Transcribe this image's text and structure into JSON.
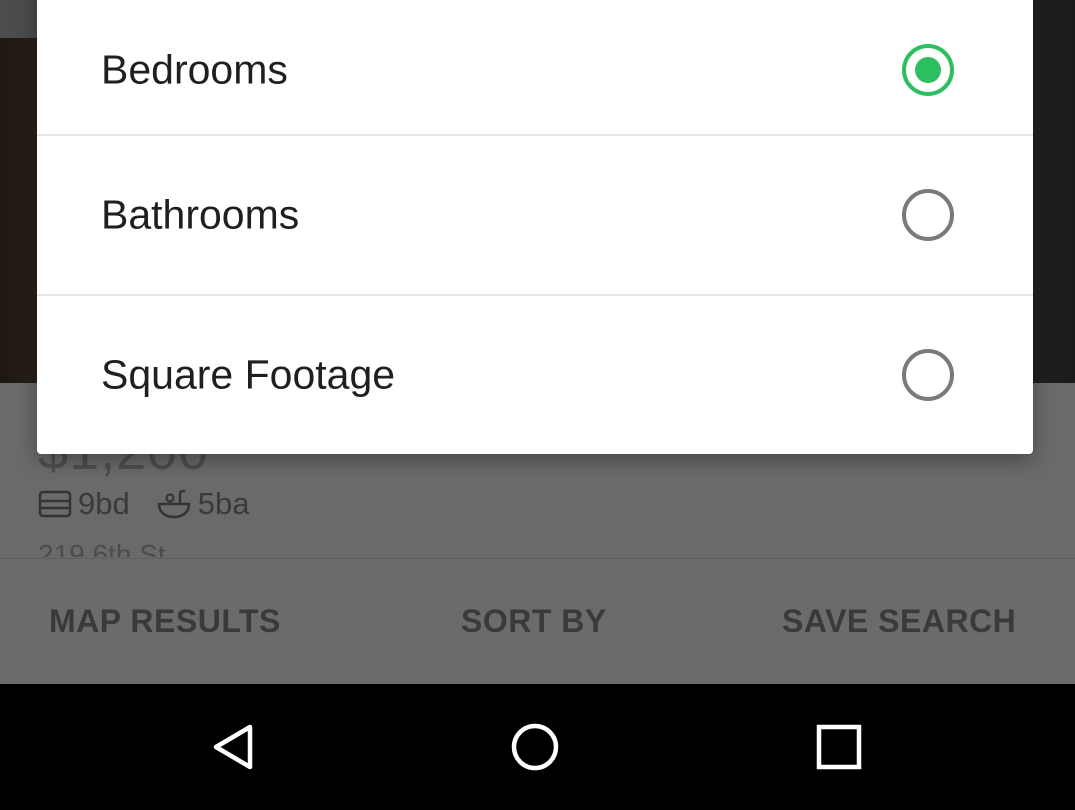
{
  "sort_dialog": {
    "options": [
      {
        "label": "Bedrooms",
        "selected": true
      },
      {
        "label": "Bathrooms",
        "selected": false
      },
      {
        "label": "Square Footage",
        "selected": false
      }
    ]
  },
  "listing": {
    "price": "$1,200",
    "bedrooms": "9bd",
    "bathrooms": "5ba",
    "address": "219 6th St"
  },
  "bottom_actions": {
    "map_results": "MAP RESULTS",
    "sort_by": "SORT BY",
    "save_search": "SAVE SEARCH"
  },
  "navbar": {
    "back_icon": "back-triangle-icon",
    "home_icon": "home-circle-icon",
    "recent_icon": "recent-apps-square-icon"
  },
  "colors": {
    "accent": "#2dbe60",
    "scrim": "#6b6b6b",
    "navbar": "#000000"
  }
}
